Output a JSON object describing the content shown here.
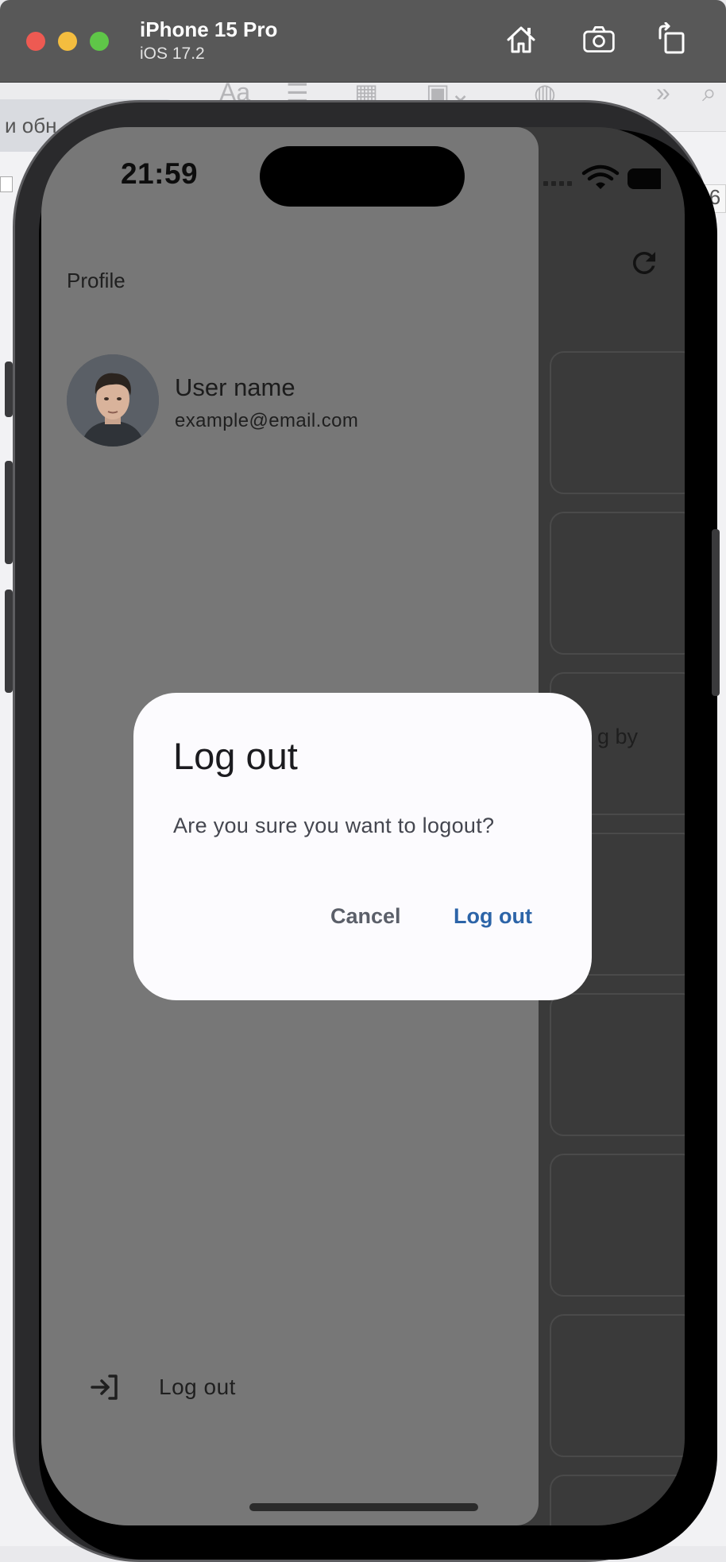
{
  "simulator": {
    "device_name": "iPhone 15 Pro",
    "os_version": "iOS 17.2",
    "buttons": [
      "home-icon",
      "screenshot-icon",
      "rotate-icon"
    ]
  },
  "desktop": {
    "tab_text": "и обн",
    "number": "6",
    "tool_text": "Aa"
  },
  "status_bar": {
    "time": "21:59"
  },
  "background_page": {
    "card_text": "g by"
  },
  "drawer": {
    "header": "Profile",
    "user_name": "User name",
    "user_email": "example@email.com",
    "logout_label": "Log out"
  },
  "dialog": {
    "title": "Log out",
    "message": "Are you sure you want to logout?",
    "cancel_label": "Cancel",
    "confirm_label": "Log out"
  },
  "colors": {
    "primary": "#2c64a8",
    "drawer": "#777777",
    "dialog": "#fcfbfe"
  }
}
